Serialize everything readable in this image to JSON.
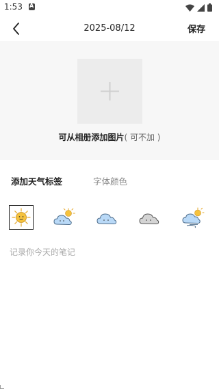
{
  "status_bar": {
    "time": "1:53",
    "icons": [
      "notification-icon",
      "wifi-icon",
      "signal-icon",
      "battery-icon"
    ]
  },
  "header": {
    "title": "2025-08/12",
    "save_label": "保存",
    "back_icon": "back-arrow-icon"
  },
  "photo": {
    "add_icon": "plus-icon",
    "hint": "可从相册添加图片",
    "hint_optional": "( 可不加 )"
  },
  "tabs": [
    {
      "label": "添加天气标签",
      "active": true
    },
    {
      "label": "字体颜色",
      "active": false
    }
  ],
  "weather_options": [
    {
      "icon": "sunny-icon",
      "selected": true
    },
    {
      "icon": "partly-cloudy-icon",
      "selected": false
    },
    {
      "icon": "cloudy-icon",
      "selected": false
    },
    {
      "icon": "overcast-icon",
      "selected": false
    },
    {
      "icon": "windy-cloud-icon",
      "selected": false
    }
  ],
  "note": {
    "placeholder": "记录你今天的笔记",
    "value": ""
  },
  "colors": {
    "accent": "#222222",
    "photo_bg": "#f7f7f7",
    "cloud_blue": "#b9d9f7",
    "sun_yellow": "#f5c23d"
  }
}
